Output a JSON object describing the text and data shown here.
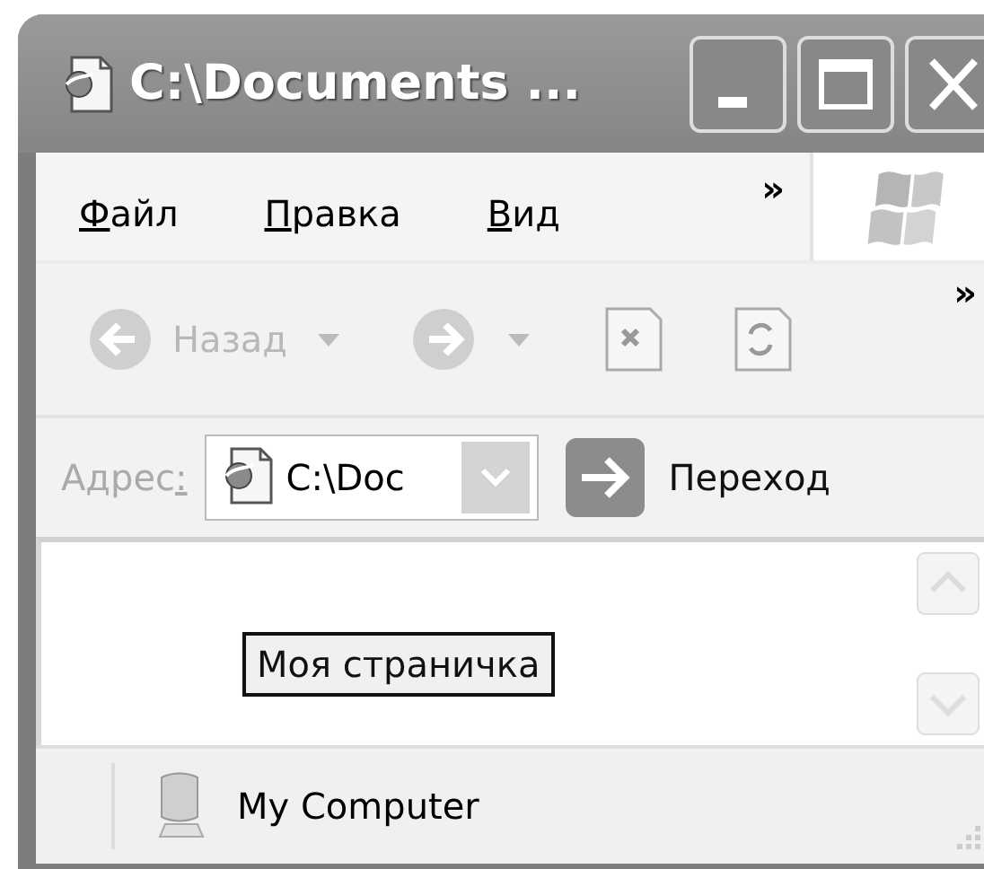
{
  "window": {
    "title": "C:\\Documents ...",
    "controls": [
      {
        "kind": "minimize"
      },
      {
        "kind": "maximize"
      },
      {
        "kind": "close"
      }
    ]
  },
  "menu": {
    "items": [
      {
        "accel": "Ф",
        "rest": "айл"
      },
      {
        "accel": "П",
        "rest": "равка"
      },
      {
        "accel": "В",
        "rest": "ид"
      }
    ],
    "overflow": "»"
  },
  "toolbar": {
    "buttons": [
      {
        "kind": "back",
        "label": "Назад",
        "disabled": true,
        "dropdown": true
      },
      {
        "kind": "forward",
        "disabled": true,
        "dropdown": true
      },
      {
        "kind": "stop",
        "disabled": true
      },
      {
        "kind": "refresh",
        "disabled": true
      }
    ],
    "overflow": "»"
  },
  "address_bar": {
    "label": "Адрес",
    "accel": ":",
    "value": "C:\\Doc",
    "go_label": "Переход"
  },
  "content": {
    "button": "Моя страничка"
  },
  "status_bar": {
    "zone": "My Computer"
  }
}
